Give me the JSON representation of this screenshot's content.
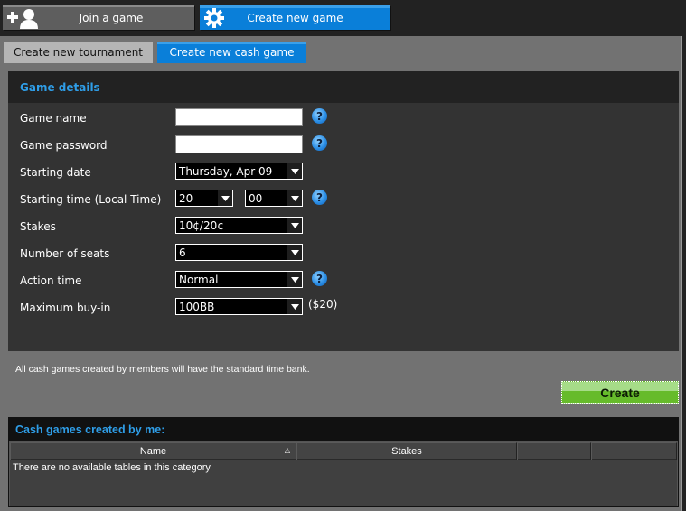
{
  "top_tabs": {
    "join": {
      "label": "Join a game",
      "icon": "add-user-icon"
    },
    "create": {
      "label": "Create new game",
      "icon": "gear-icon"
    }
  },
  "sub_tabs": {
    "tournament": "Create new tournament",
    "cash": "Create new cash game"
  },
  "details": {
    "title": "Game details",
    "fields": {
      "game_name": {
        "label": "Game name",
        "value": ""
      },
      "game_password": {
        "label": "Game password",
        "value": ""
      },
      "starting_date": {
        "label": "Starting date",
        "value": "Thursday, Apr 09"
      },
      "starting_time": {
        "label": "Starting time (Local Time)",
        "hour": "20",
        "minute": "00"
      },
      "stakes": {
        "label": "Stakes",
        "value": "10¢/20¢"
      },
      "seats": {
        "label": "Number of seats",
        "value": "6"
      },
      "action_time": {
        "label": "Action time",
        "value": "Normal"
      },
      "max_buyin": {
        "label": "Maximum buy-in",
        "value": "100BB",
        "suffix": "($20)"
      }
    },
    "help_glyph": "?"
  },
  "note": "All cash games created by members will have the standard time bank.",
  "create_button": "Create",
  "my_games": {
    "title": "Cash games created by me:",
    "columns": [
      "Name",
      "Stakes",
      "",
      ""
    ],
    "sort_indicator": "△",
    "empty_message": "There are no available tables in this category"
  },
  "colors": {
    "accent_blue": "#0a7fd9",
    "heading_blue": "#2f9ee8",
    "create_green": "#66bb2b"
  }
}
